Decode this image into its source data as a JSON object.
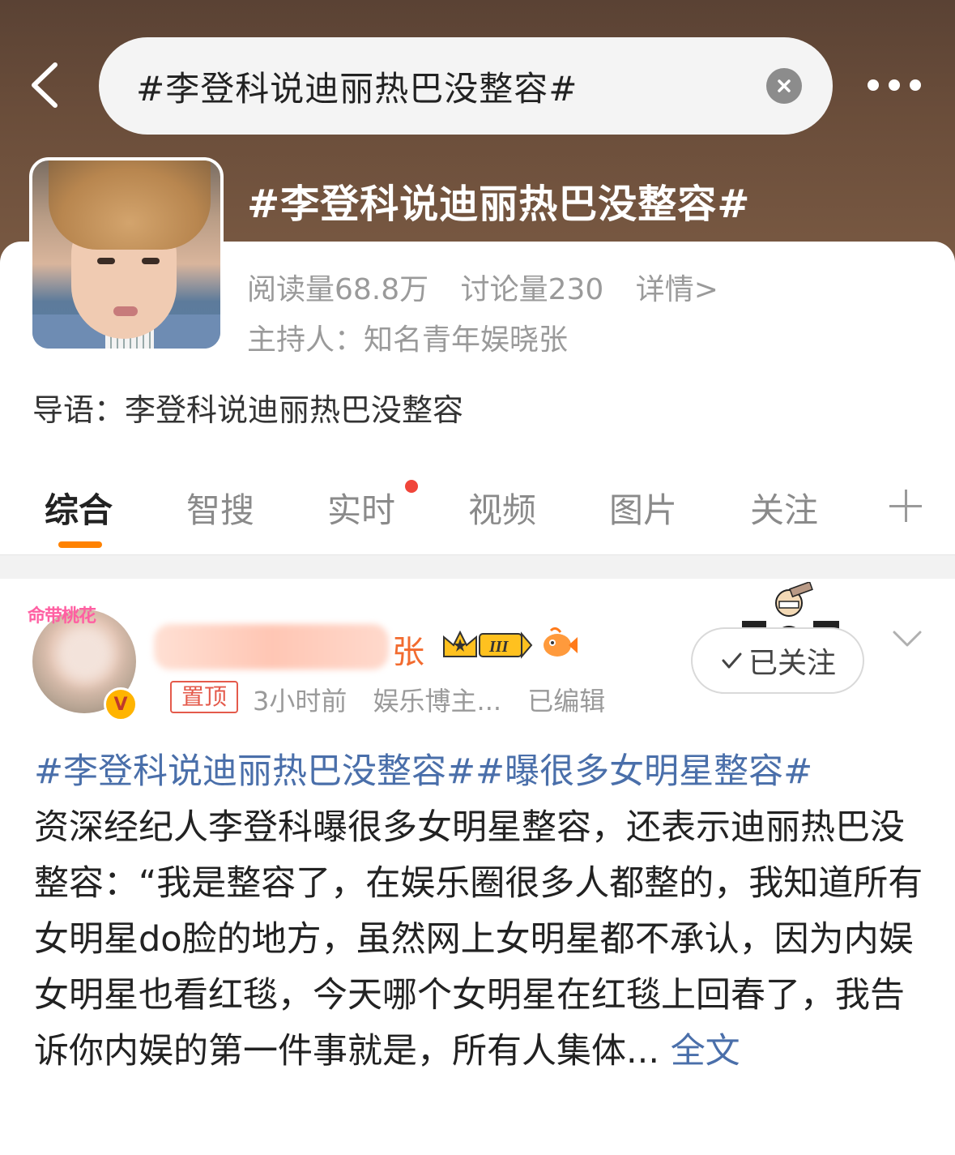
{
  "header": {
    "search_value": "#李登科说迪丽热巴没整容#",
    "title": "#李登科说迪丽热巴没整容#",
    "icons": [
      "back-icon",
      "clear-icon",
      "more-icon"
    ]
  },
  "topic": {
    "reads": "阅读量68.8万",
    "discussions": "讨论量230",
    "details": "详情>",
    "host": "主持人：知名青年娱晓张",
    "intro": "导语：李登科说迪丽热巴没整容"
  },
  "tabs": [
    "综合",
    "智搜",
    "实时",
    "视频",
    "图片",
    "关注"
  ],
  "post": {
    "username_suffix": "张",
    "top_label": "置顶",
    "time": "3小时前",
    "source": "娱乐博主...",
    "edited": "已编辑",
    "follow_label": "已关注",
    "hashtags": "#李登科说迪丽热巴没整容##曝很多女明星整容#",
    "text": "资深经纪人李登科曝很多女明星整容，还表示迪丽热巴没整容：“我是整容了，在娱乐圈很多人都整的，我知道所有女明星do脸的地方，虽然网上女明星都不承认，因为内娱女明星也看红毯，今天哪个女明星在红毯上回春了，我告诉你内娱的第一件事就是，所有人集体...",
    "more_label": "全文",
    "badge_text": "命带桃花",
    "level_label": "III",
    "verified_icon": "V"
  },
  "colors": {
    "accent": "#ff8200",
    "link": "#4a6faa",
    "badge_red": "#e45a4b",
    "hero": "#6a4d3a"
  }
}
